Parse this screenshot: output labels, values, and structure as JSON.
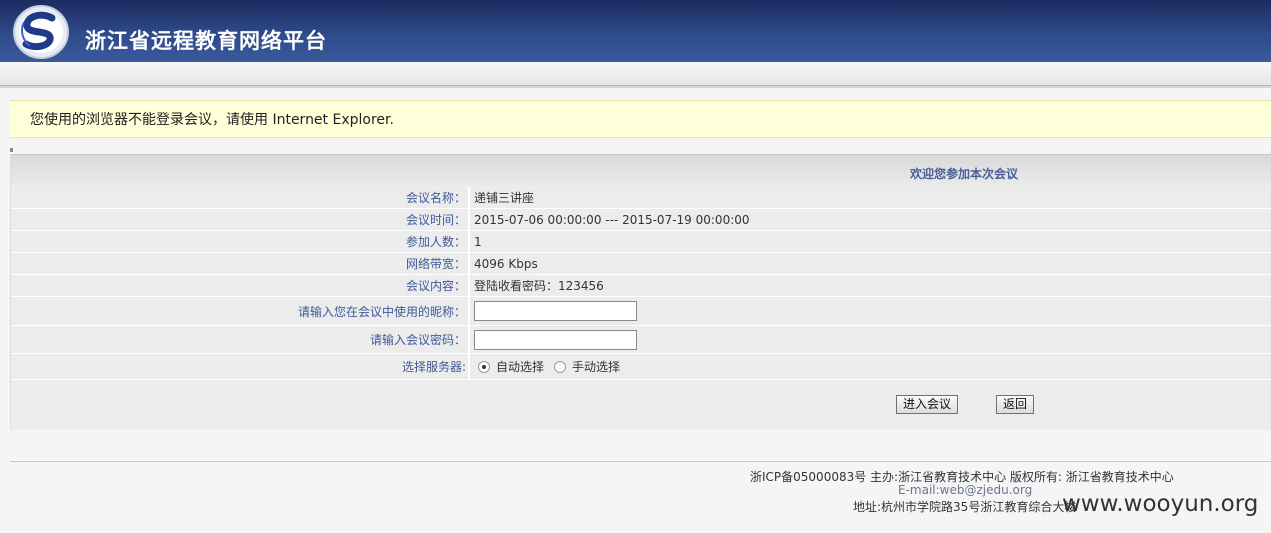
{
  "header": {
    "site_title": "浙江省远程教育网络平台",
    "logo_icon": "swirl-logo-icon",
    "colors": {
      "bar_top": "#1b2c5f",
      "bar_bottom": "#3a5a9c"
    }
  },
  "notice": {
    "message": "您使用的浏览器不能登录会议，请使用 Internet Explorer.",
    "bg_color": "#ffffd9"
  },
  "panel": {
    "title": "欢迎您参加本次会议",
    "rows": [
      {
        "label": "会议名称：",
        "value": "递铺三讲座"
      },
      {
        "label": "会议时间：",
        "value": "2015-07-06 00:00:00 --- 2015-07-19 00:00:00"
      },
      {
        "label": "参加人数：",
        "value": "1"
      },
      {
        "label": "网络带宽：",
        "value": "4096 Kbps"
      },
      {
        "label": "会议内容：",
        "value": "登陆收看密码：123456"
      }
    ],
    "nickname_label": "请输入您在会议中使用的昵称：",
    "nickname_value": "",
    "password_label": "请输入会议密码：",
    "password_value": "",
    "server_label": "选择服务器:",
    "server_options": [
      {
        "label": "自动选择",
        "selected": true
      },
      {
        "label": "手动选择",
        "selected": false
      }
    ],
    "enter_button": "进入会议",
    "back_button": "返回"
  },
  "footer": {
    "line1": "浙ICP备05000083号 主办:浙江省教育技术中心 版权所有: 浙江省教育技术中心",
    "email": "E-mail:web@zjedu.org",
    "address": "地址:杭州市学院路35号浙江教育综合大楼"
  },
  "watermark": "www.wooyun.org"
}
